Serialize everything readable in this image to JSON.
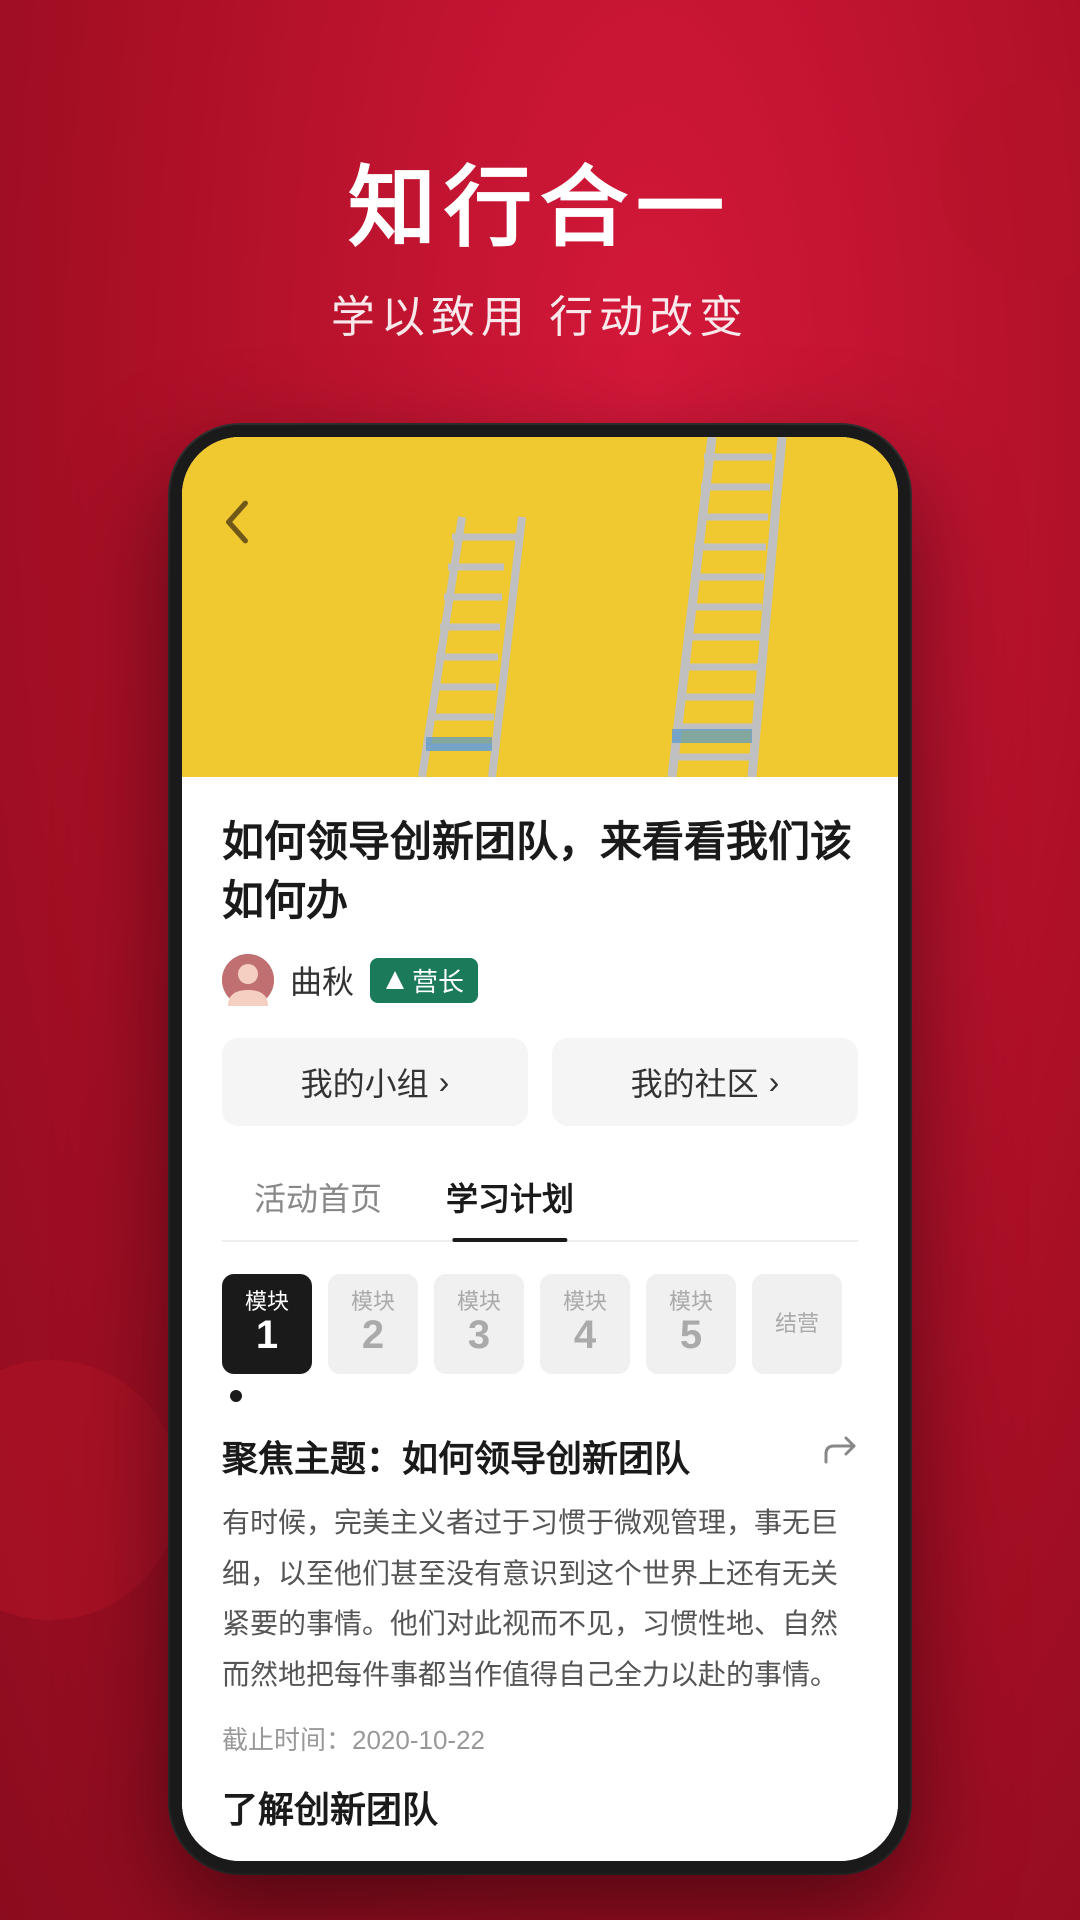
{
  "header": {
    "main_title": "知行合一",
    "sub_title": "学以致用 行动改变"
  },
  "phone": {
    "back_button": "‹",
    "article": {
      "title": "如何领导创新团队，来看看我们该如何办",
      "author_name": "曲秋",
      "author_badge": "营长",
      "nav": {
        "my_group": "我的小组",
        "my_community": "我的社区",
        "chevron": "›"
      },
      "tabs": [
        {
          "label": "活动首页",
          "active": false
        },
        {
          "label": "学习计划",
          "active": true
        }
      ],
      "modules": [
        {
          "label": "模块",
          "num": "1",
          "active": true
        },
        {
          "label": "模块",
          "num": "2",
          "active": false
        },
        {
          "label": "模块",
          "num": "3",
          "active": false
        },
        {
          "label": "模块",
          "num": "4",
          "active": false
        },
        {
          "label": "模块",
          "num": "5",
          "active": false
        },
        {
          "label": "结营",
          "num": "",
          "active": false
        }
      ],
      "focus": {
        "title": "聚焦主题：如何领导创新团队",
        "content": "有时候，完美主义者过于习惯于微观管理，事无巨细，以至他们甚至没有意识到这个世界上还有无关紧要的事情。他们对此视而不见，习惯性地、自然而然地把每件事都当作值得自己全力以赴的事情。",
        "deadline": "截止时间：2020-10-22",
        "learn_title": "了解创新团队"
      }
    }
  }
}
